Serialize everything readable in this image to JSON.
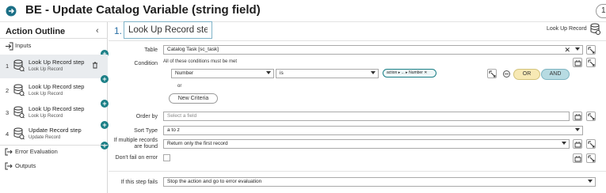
{
  "header": {
    "title": "BE - Update Catalog Variable (string field)",
    "pill_text": "1"
  },
  "outline": {
    "title": "Action Outline",
    "inputs_label": "Inputs",
    "steps": [
      {
        "number": "1",
        "name": "Look Up Record step",
        "type": "Look Up Record"
      },
      {
        "number": "2",
        "name": "Look Up Record step",
        "type": "Look Up Record"
      },
      {
        "number": "3",
        "name": "Look Up Record step",
        "type": "Look Up Record"
      },
      {
        "number": "4",
        "name": "Update Record step",
        "type": "Update Record"
      }
    ],
    "error_label": "Error Evaluation",
    "outputs_label": "Outputs",
    "plus_symbol": "+"
  },
  "main": {
    "step_number": "1.",
    "step_title": "Look Up Record step",
    "action_type": "Look Up Record",
    "table": {
      "label": "Table",
      "value": "Catalog Task [sc_task]"
    },
    "condition": {
      "label": "Condition",
      "note": "All of these conditions must be met",
      "field": "Number",
      "operator": "is",
      "chip": "action ▸ ... ▸ Number ✕",
      "or_label": "or",
      "new_criteria": "New Criteria",
      "or_btn": "OR",
      "and_btn": "AND"
    },
    "order_by": {
      "label": "Order by",
      "placeholder": "Select a field"
    },
    "sort_type": {
      "label": "Sort Type",
      "value": "a to z"
    },
    "multiple": {
      "label_1": "If multiple records",
      "label_2": "are found",
      "value": "Return only the first record"
    },
    "dont_fail": {
      "label": "Don't fail on error",
      "checked": false
    },
    "if_fails": {
      "label": "If this step fails",
      "value": "Stop the action and go to error evaluation"
    }
  },
  "colors": {
    "accent": "#1b7f86",
    "or": "#f7e9b4",
    "and": "#b7dbe2"
  }
}
